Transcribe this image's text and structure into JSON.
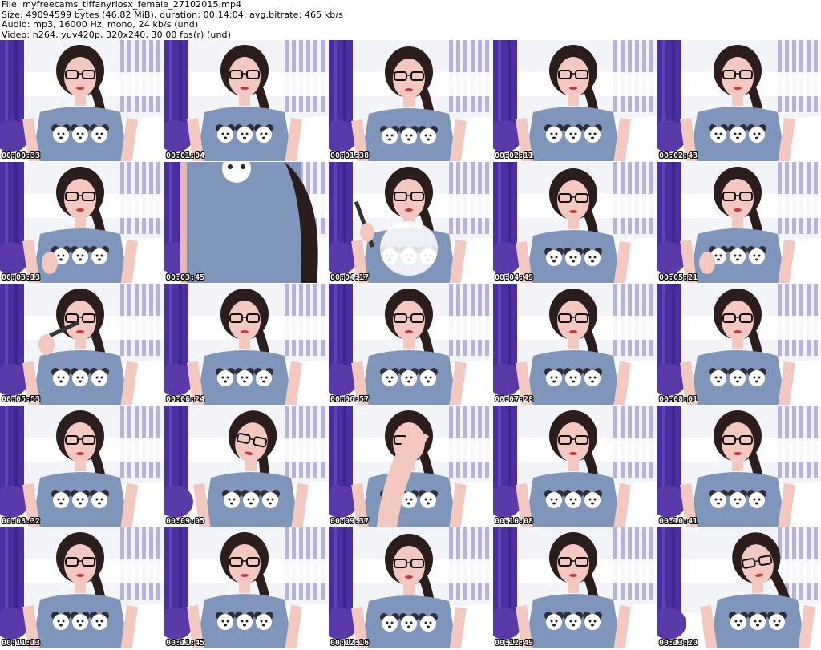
{
  "header": {
    "file": "File: myfreecams_tiffanyriosx_female_27102015.mp4",
    "size": "Size: 49094599 bytes (46.82 MiB), duration: 00:14:04, avg.bitrate: 465 kb/s",
    "audio": "Audio: mp3, 16000 Hz, mono, 24 kb/s (und)",
    "video": "Video: h264, yuv420p, 320x240, 30.00 fps(r) (und)"
  },
  "thumbnails": [
    {
      "timestamp": "00:00:33",
      "pose": "center"
    },
    {
      "timestamp": "00:01:04",
      "pose": "center"
    },
    {
      "timestamp": "00:01:38",
      "pose": "down"
    },
    {
      "timestamp": "00:02:11",
      "pose": "center"
    },
    {
      "timestamp": "00:02:43",
      "pose": "center"
    },
    {
      "timestamp": "00:03:13",
      "pose": "hand"
    },
    {
      "timestamp": "00:03:45",
      "pose": "closeup"
    },
    {
      "timestamp": "00:04:17",
      "pose": "vape"
    },
    {
      "timestamp": "00:04:49",
      "pose": "down"
    },
    {
      "timestamp": "00:05:21",
      "pose": "smile"
    },
    {
      "timestamp": "00:05:53",
      "pose": "pen"
    },
    {
      "timestamp": "00:06:24",
      "pose": "center"
    },
    {
      "timestamp": "00:06:57",
      "pose": "center"
    },
    {
      "timestamp": "00:07:28",
      "pose": "center"
    },
    {
      "timestamp": "00:08:01",
      "pose": "center"
    },
    {
      "timestamp": "00:08:32",
      "pose": "center"
    },
    {
      "timestamp": "00:09:05",
      "pose": "tilt"
    },
    {
      "timestamp": "00:09:37",
      "pose": "arm"
    },
    {
      "timestamp": "00:10:08",
      "pose": "center"
    },
    {
      "timestamp": "00:10:41",
      "pose": "center"
    },
    {
      "timestamp": "00:11:13",
      "pose": "center"
    },
    {
      "timestamp": "00:11:45",
      "pose": "center"
    },
    {
      "timestamp": "00:12:16",
      "pose": "down"
    },
    {
      "timestamp": "00:12:49",
      "pose": "center"
    },
    {
      "timestamp": "00:13:20",
      "pose": "side"
    }
  ],
  "colors": {
    "wall": "#f2f4f8",
    "curtain": "#4b2e9f",
    "shirt": "#7f96ba",
    "hair": "#2a1d1b",
    "skin": "#f2c8c1"
  }
}
